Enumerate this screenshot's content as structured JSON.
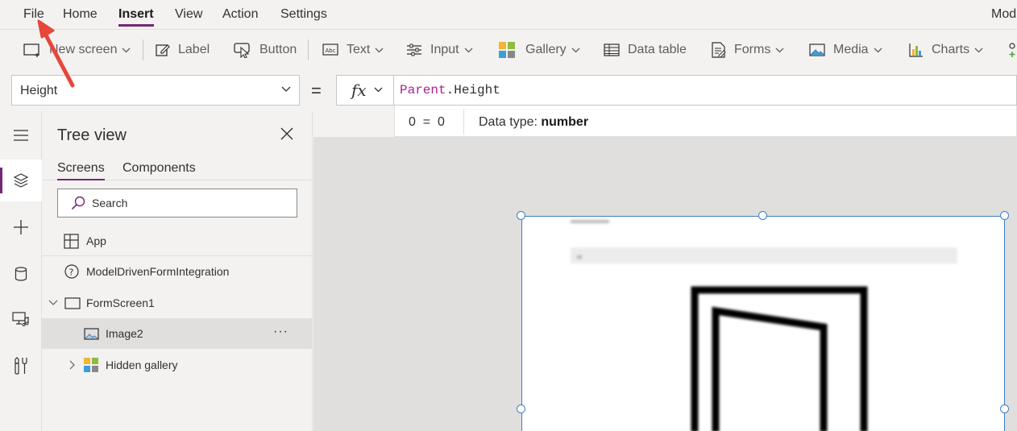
{
  "menubar": {
    "items": [
      "File",
      "Home",
      "Insert",
      "View",
      "Action",
      "Settings"
    ],
    "active": "Insert",
    "right_text": "Mod"
  },
  "ribbon": {
    "new_screen": "New screen",
    "label": "Label",
    "button": "Button",
    "text": "Text",
    "input": "Input",
    "gallery": "Gallery",
    "data_table": "Data table",
    "forms": "Forms",
    "media": "Media",
    "charts": "Charts"
  },
  "formula_bar": {
    "property": "Height",
    "equals": "=",
    "fx": "fx",
    "formula_keyword": "Parent",
    "formula_rest": ".Height",
    "result": "0  =  0",
    "data_type_label": "Data type: ",
    "data_type_value": "number"
  },
  "tree_view": {
    "title": "Tree view",
    "tabs": [
      "Screens",
      "Components"
    ],
    "active_tab": "Screens",
    "search_placeholder": "Search",
    "items": [
      {
        "label": "App",
        "icon": "app-grid-icon"
      },
      {
        "label": "ModelDrivenFormIntegration",
        "icon": "help-circle-icon"
      },
      {
        "label": "FormScreen1",
        "icon": "screen-icon",
        "expanded": true
      },
      {
        "label": "Image2",
        "icon": "image-icon",
        "selected": true
      },
      {
        "label": "Hidden gallery",
        "icon": "gallery-icon",
        "collapsed": true
      }
    ],
    "more": "···"
  },
  "colors": {
    "accent": "#742774",
    "selection": "#3a7fc6",
    "arrow": "#e8463a"
  }
}
